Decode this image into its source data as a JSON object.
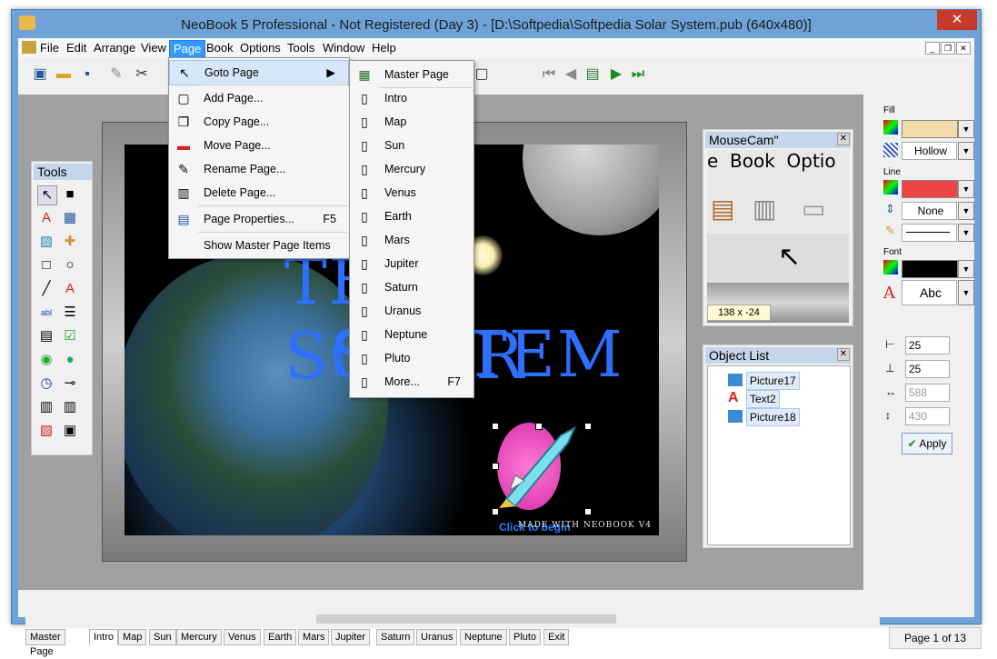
{
  "window": {
    "title": "NeoBook 5 Professional - Not Registered (Day 3) - [D:\\Softpedia\\Softpedia Solar System.pub (640x480)]",
    "close": "✕"
  },
  "menubar": {
    "items": [
      "File",
      "Edit",
      "Arrange",
      "View",
      "Page",
      "Book",
      "Options",
      "Tools",
      "Window",
      "Help"
    ]
  },
  "page_menu": {
    "items": [
      {
        "label": "Goto Page",
        "shortcut": "▶"
      },
      {
        "label": "Add Page...",
        "shortcut": ""
      },
      {
        "label": "Copy Page...",
        "shortcut": ""
      },
      {
        "label": "Move Page...",
        "shortcut": ""
      },
      {
        "label": "Rename Page...",
        "shortcut": ""
      },
      {
        "label": "Delete Page...",
        "shortcut": ""
      },
      {
        "label": "Page Properties...",
        "shortcut": "F5"
      },
      {
        "label": "Show Master Page Items",
        "shortcut": ""
      }
    ]
  },
  "goto_submenu": {
    "items": [
      "Master Page",
      "Intro",
      "Map",
      "Sun",
      "Mercury",
      "Venus",
      "Earth",
      "Mars",
      "Jupiter",
      "Saturn",
      "Uranus",
      "Neptune",
      "Pluto",
      "More..."
    ],
    "more_shortcut": "F7"
  },
  "canvas": {
    "title_line1": "THE SOLAR",
    "title_line2": "SYSTEM",
    "click_to_begin": "Click to begin",
    "made_with": "MADE WITH NEOBOOK V4"
  },
  "tools_panel": {
    "title": "Tools"
  },
  "mousecam": {
    "title": "MouseCam\"",
    "menu_peek": "e  Book  Optio",
    "coords": "138 x -24"
  },
  "object_list": {
    "title": "Object List",
    "items": [
      "Picture17",
      "Text2",
      "Picture18"
    ]
  },
  "properties": {
    "fill_label": "Fill",
    "fill_color": "#f2dba8",
    "fill_style": "Hollow",
    "line_label": "Line",
    "line_color": "#ee4444",
    "line_style": "None",
    "font_label": "Font",
    "font_color": "#000000",
    "font_sample": "Abc",
    "x": "25",
    "y": "25",
    "w": "588",
    "h": "430",
    "apply": "Apply"
  },
  "page_tabs": [
    "Master Page",
    "Intro",
    "Map",
    "Sun",
    "Mercury",
    "Venus",
    "Earth",
    "Mars",
    "Jupiter",
    "Saturn",
    "Uranus",
    "Neptune",
    "Pluto",
    "Exit"
  ],
  "status": {
    "page": "Page 1 of 13"
  }
}
